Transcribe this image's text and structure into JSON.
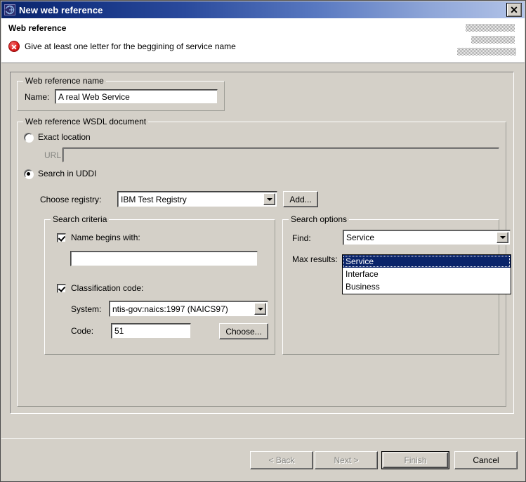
{
  "window": {
    "title": "New web reference",
    "icon": "web-reference-icon",
    "close_label": "✕"
  },
  "header": {
    "title": "Web reference",
    "message": "Give at least one letter for the beggining of service name",
    "status_icon": "error-icon",
    "decoration": "dithered-banner-graphic"
  },
  "name_group": {
    "legend": "Web reference name",
    "name_label": "Name:",
    "name_value": "A real Web Service",
    "name_placeholder": ""
  },
  "wsdl_group": {
    "legend": "Web reference WSDL document",
    "exact_location_label": "Exact location",
    "exact_location_selected": false,
    "url_label": "URL",
    "url_value": "",
    "url_placeholder": "",
    "url_enabled": false,
    "search_uddi_label": "Search in UDDI",
    "search_uddi_selected": true,
    "registry_label": "Choose registry:",
    "registry_value": "IBM Test Registry",
    "registry_options": [
      "IBM Test Registry"
    ],
    "add_button": "Add..."
  },
  "search_criteria": {
    "legend": "Search criteria",
    "name_begins_label": "Name begins with:",
    "name_begins_checked": true,
    "name_begins_value": "",
    "name_begins_placeholder": "",
    "classification_label": "Classification code:",
    "classification_checked": true,
    "system_label": "System:",
    "system_value": "ntis-gov:naics:1997 (NAICS97)",
    "system_options": [
      "ntis-gov:naics:1997 (NAICS97)"
    ],
    "code_label": "Code:",
    "code_value": "51",
    "code_placeholder": "",
    "choose_button": "Choose..."
  },
  "search_options": {
    "legend": "Search options",
    "find_label": "Find:",
    "find_value": "Service",
    "find_options": [
      "Service",
      "Interface",
      "Business"
    ],
    "find_selected_index": 0,
    "find_expanded": true,
    "max_results_label": "Max results:"
  },
  "footer": {
    "back_label": "< Back",
    "back_enabled": false,
    "next_label": "Next >",
    "next_enabled": false,
    "finish_label": "Finish",
    "finish_enabled": false,
    "finish_default": true,
    "cancel_label": "Cancel",
    "cancel_enabled": true
  },
  "colors": {
    "title_bar_start": "#0a246a",
    "title_bar_end": "#b3c4e8",
    "dialog_face": "#d4d0c8",
    "selection": "#0a246a",
    "error": "#e02020",
    "disabled_text": "#868682"
  }
}
